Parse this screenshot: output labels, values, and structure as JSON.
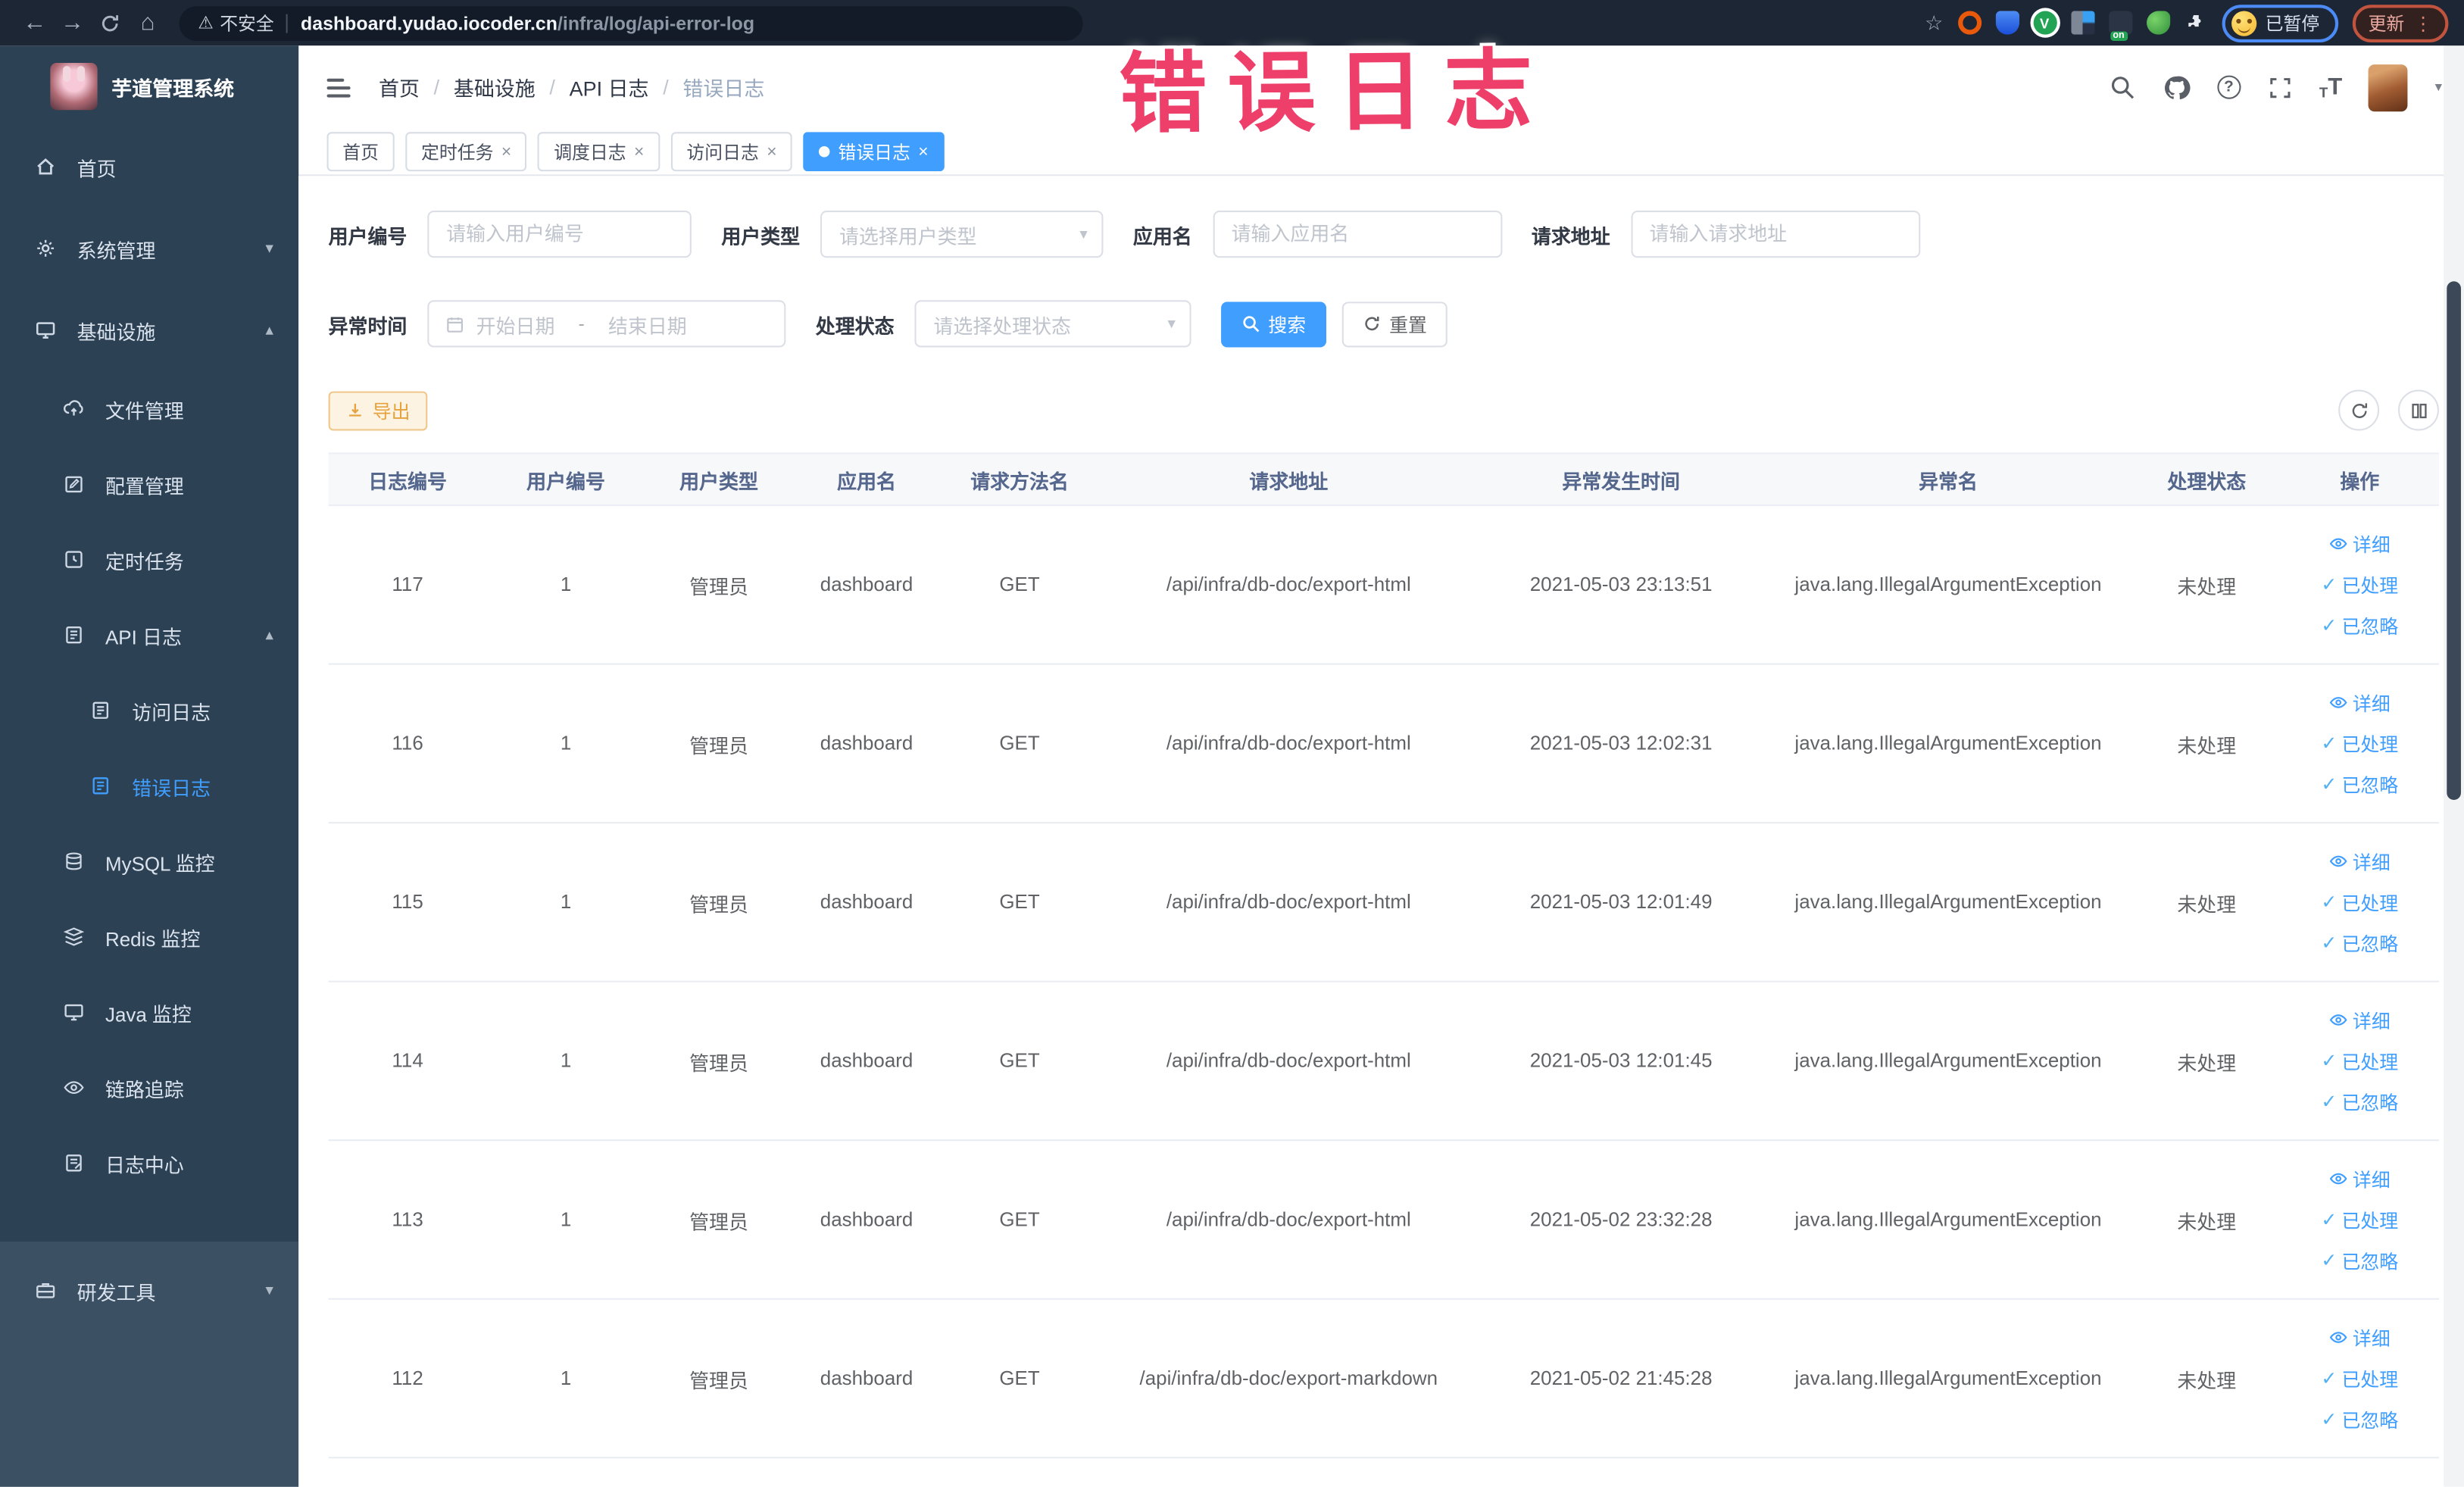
{
  "browser": {
    "back_icon": "←",
    "forward_icon": "→",
    "home_icon": "⌂",
    "star_icon": "☆",
    "warning_icon": "⚠",
    "security_label": "不安全",
    "url_domain": "dashboard.yudao.iocoder.cn",
    "url_path": "/infra/log/api-error-log",
    "extension_v": "V",
    "extension_badge": "on",
    "profile_label": "已暂停",
    "update_label": "更新",
    "kebab_icon": "⋮"
  },
  "annotation": {
    "text": "错误日志",
    "color": "#ee3f6a"
  },
  "sidebar": {
    "title": "芋道管理系统",
    "items": [
      {
        "label": "首页"
      },
      {
        "label": "系统管理"
      },
      {
        "label": "基础设施"
      },
      {
        "label": "文件管理"
      },
      {
        "label": "配置管理"
      },
      {
        "label": "定时任务"
      },
      {
        "label": "API 日志"
      },
      {
        "label": "访问日志"
      },
      {
        "label": "错误日志"
      },
      {
        "label": "MySQL 监控"
      },
      {
        "label": "Redis 监控"
      },
      {
        "label": "Java 监控"
      },
      {
        "label": "链路追踪"
      },
      {
        "label": "日志中心"
      },
      {
        "label": "研发工具"
      }
    ]
  },
  "header": {
    "breadcrumbs": [
      "首页",
      "基础设施",
      "API 日志",
      "错误日志"
    ],
    "separator": "/"
  },
  "tabs": [
    {
      "label": "首页"
    },
    {
      "label": "定时任务"
    },
    {
      "label": "调度日志"
    },
    {
      "label": "访问日志"
    },
    {
      "label": "错误日志"
    }
  ],
  "icons": {
    "close": "×",
    "check": "✓",
    "chevron_down": "▾",
    "chevron_up": "▴",
    "select_caret": "▾",
    "help": "?",
    "fontsize_big": "T",
    "fontsize_small": "T"
  },
  "filters": {
    "user_id": {
      "label": "用户编号",
      "placeholder": "请输入用户编号"
    },
    "user_type": {
      "label": "用户类型",
      "placeholder": "请选择用户类型"
    },
    "app_name": {
      "label": "应用名",
      "placeholder": "请输入应用名"
    },
    "request_url": {
      "label": "请求地址",
      "placeholder": "请输入请求地址"
    },
    "exception_time": {
      "label": "异常时间",
      "start_placeholder": "开始日期",
      "separator": "-",
      "end_placeholder": "结束日期"
    },
    "process_status": {
      "label": "处理状态",
      "placeholder": "请选择处理状态"
    },
    "search_label": "搜索",
    "reset_label": "重置"
  },
  "toolbar": {
    "export_label": "导出"
  },
  "table": {
    "columns": [
      "日志编号",
      "用户编号",
      "用户类型",
      "应用名",
      "请求方法名",
      "请求地址",
      "异常发生时间",
      "异常名",
      "处理状态",
      "操作"
    ],
    "actions": [
      "详细",
      "已处理",
      "已忽略"
    ],
    "rows": [
      {
        "id": "117",
        "user_id": "1",
        "user_type": "管理员",
        "app": "dashboard",
        "method": "GET",
        "url": "/api/infra/db-doc/export-html",
        "time": "2021-05-03 23:13:51",
        "exception": "java.lang.IllegalArgumentException",
        "status": "未处理"
      },
      {
        "id": "116",
        "user_id": "1",
        "user_type": "管理员",
        "app": "dashboard",
        "method": "GET",
        "url": "/api/infra/db-doc/export-html",
        "time": "2021-05-03 12:02:31",
        "exception": "java.lang.IllegalArgumentException",
        "status": "未处理"
      },
      {
        "id": "115",
        "user_id": "1",
        "user_type": "管理员",
        "app": "dashboard",
        "method": "GET",
        "url": "/api/infra/db-doc/export-html",
        "time": "2021-05-03 12:01:49",
        "exception": "java.lang.IllegalArgumentException",
        "status": "未处理"
      },
      {
        "id": "114",
        "user_id": "1",
        "user_type": "管理员",
        "app": "dashboard",
        "method": "GET",
        "url": "/api/infra/db-doc/export-html",
        "time": "2021-05-03 12:01:45",
        "exception": "java.lang.IllegalArgumentException",
        "status": "未处理"
      },
      {
        "id": "113",
        "user_id": "1",
        "user_type": "管理员",
        "app": "dashboard",
        "method": "GET",
        "url": "/api/infra/db-doc/export-html",
        "time": "2021-05-02 23:32:28",
        "exception": "java.lang.IllegalArgumentException",
        "status": "未处理"
      },
      {
        "id": "112",
        "user_id": "1",
        "user_type": "管理员",
        "app": "dashboard",
        "method": "GET",
        "url": "/api/infra/db-doc/export-markdown",
        "time": "2021-05-02 21:45:28",
        "exception": "java.lang.IllegalArgumentException",
        "status": "未处理"
      }
    ]
  },
  "colors": {
    "accent": "#409eff",
    "warning": "#e6a23c",
    "sidebar_bg": "#2d4154",
    "annotation": "#ee3f6a"
  }
}
